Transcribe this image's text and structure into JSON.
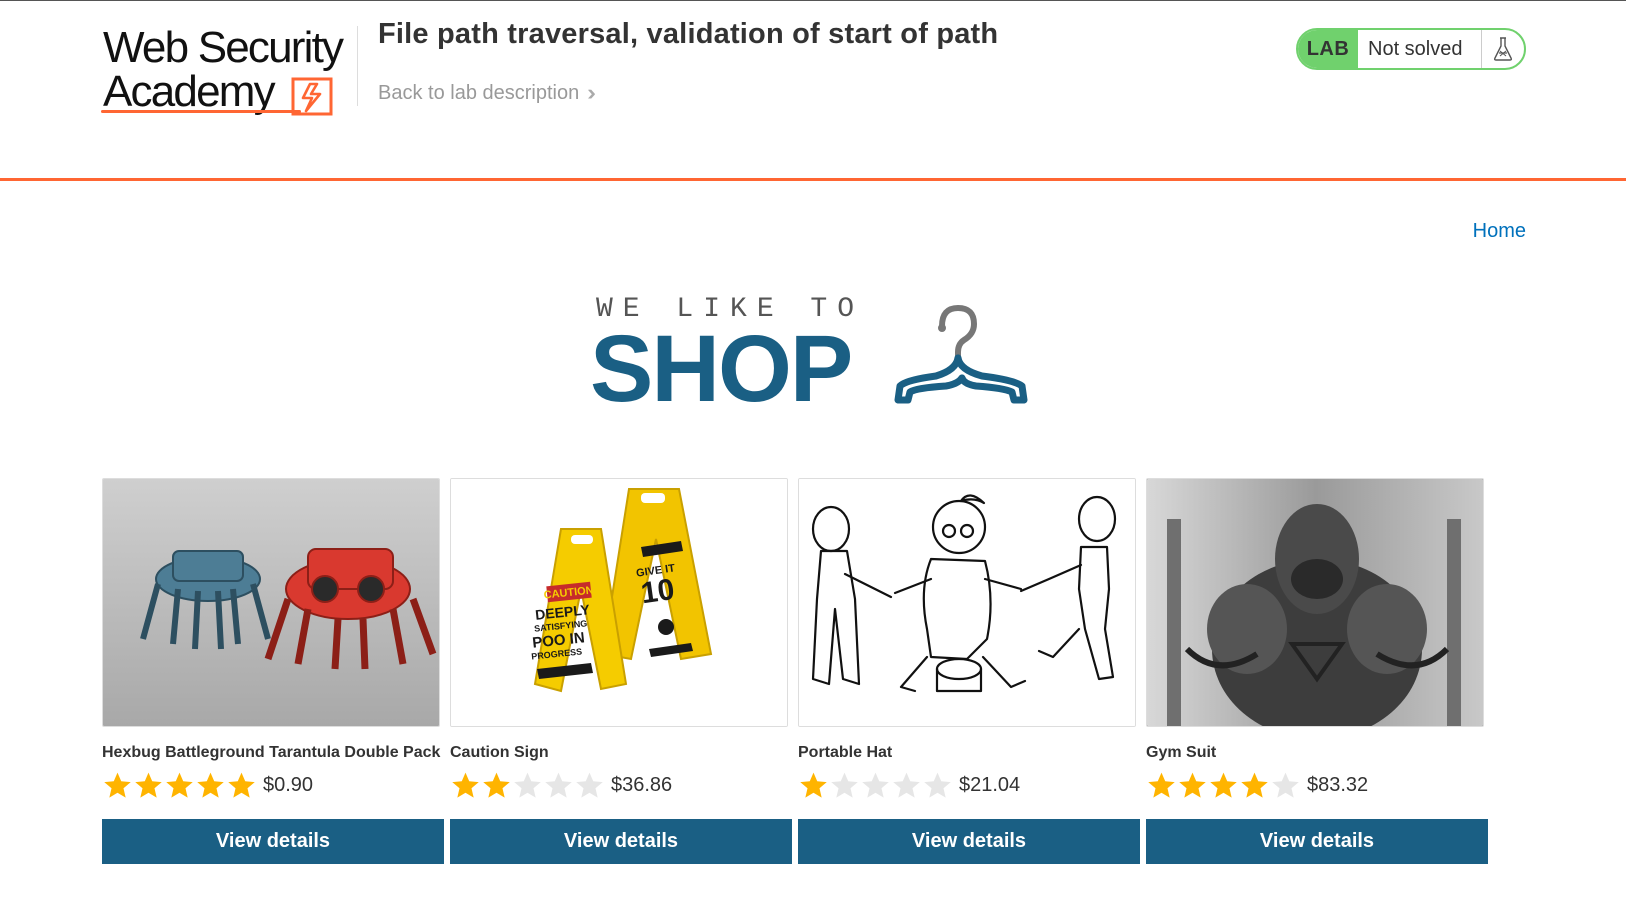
{
  "header": {
    "logo_line1": "Web Security",
    "logo_line2": "Academy",
    "lab_title": "File path traversal, validation of start of path",
    "back_link": "Back to lab description",
    "lab_badge": {
      "label": "LAB",
      "status": "Not solved"
    }
  },
  "nav": {
    "home": "Home"
  },
  "banner": {
    "tagline": "WE LIKE TO",
    "word": "SHOP"
  },
  "products": [
    {
      "name": "Hexbug Battleground Tarantula Double Pack",
      "rating": 5,
      "price": "$0.90",
      "button": "View details"
    },
    {
      "name": "Caution Sign",
      "rating": 2,
      "price": "$36.86",
      "button": "View details"
    },
    {
      "name": "Portable Hat",
      "rating": 1,
      "price": "$21.04",
      "button": "View details"
    },
    {
      "name": "Gym Suit",
      "rating": 4,
      "price": "$83.32",
      "button": "View details"
    }
  ],
  "colors": {
    "brand_blue": "#1a5f84",
    "accent_orange": "#ff6633",
    "lab_green": "#70d16d",
    "star_filled": "#ffb400",
    "star_empty": "#e6e6e6"
  }
}
